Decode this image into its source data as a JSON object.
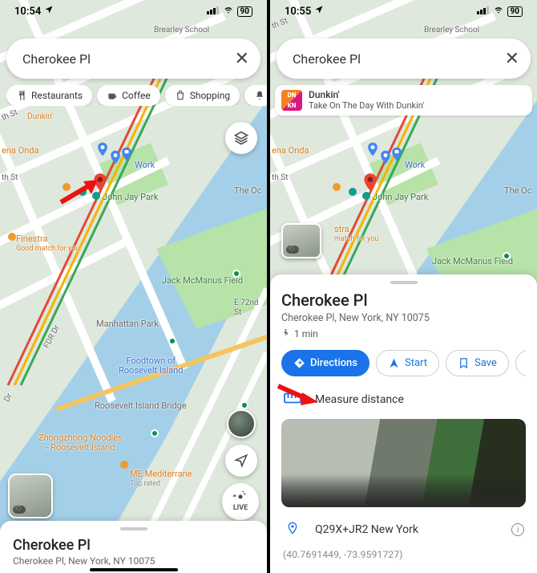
{
  "left": {
    "status": {
      "time": "10:54",
      "battery": "90"
    },
    "search": {
      "text": "Cherokee Pl"
    },
    "chips": {
      "restaurants": "Restaurants",
      "coffee": "Coffee",
      "shopping": "Shopping"
    },
    "live_label": "LIVE",
    "sheet": {
      "title": "Cherokee Pl",
      "address": "Cherokee Pl, New York, NY 10075"
    }
  },
  "right": {
    "status": {
      "time": "10:55",
      "battery": "90"
    },
    "search": {
      "text": "Cherokee Pl"
    },
    "promo": {
      "title": "Dunkin'",
      "subtitle": "Take On The Day With Dunkin'",
      "logo_text": "DN\nKN"
    },
    "sheet": {
      "title": "Cherokee Pl",
      "address": "Cherokee Pl, New York, NY 10075",
      "walk_time": "1 min",
      "actions": {
        "directions": "Directions",
        "start": "Start",
        "save": "Save"
      },
      "measure": "Measure distance",
      "plus_code": "Q29X+JR2 New York",
      "coords": "(40.7691449, -73.9591727)"
    }
  },
  "map_labels": {
    "brearley": "Brearley School",
    "dunkin": "Dunkin'",
    "ena": "ena Onda",
    "work": "Work",
    "jjp": "John Jay Park",
    "theoc": "The Oc",
    "finestra": "Finestra",
    "finestra_sub": "Good match for you",
    "mcmanus": "Jack McManus Field",
    "manhattan": "Manhattan Park",
    "foodtown": "Foodtown of",
    "foodtown2": "Roosevelt Island",
    "ribridge": "Roosevelt Island Bridge",
    "zhong": "Zhongzhong Noodles",
    "zhong2": "- Roosevelt Island",
    "me": "ME Mediterrane",
    "me_sub": "Top rated",
    "e72": "E 72nd St",
    "th": "th St",
    "thst": "th St",
    "fdr": "FDR Dr",
    "dr2": "Dr",
    "stra": "stra",
    "stra_sub": "match for you"
  }
}
